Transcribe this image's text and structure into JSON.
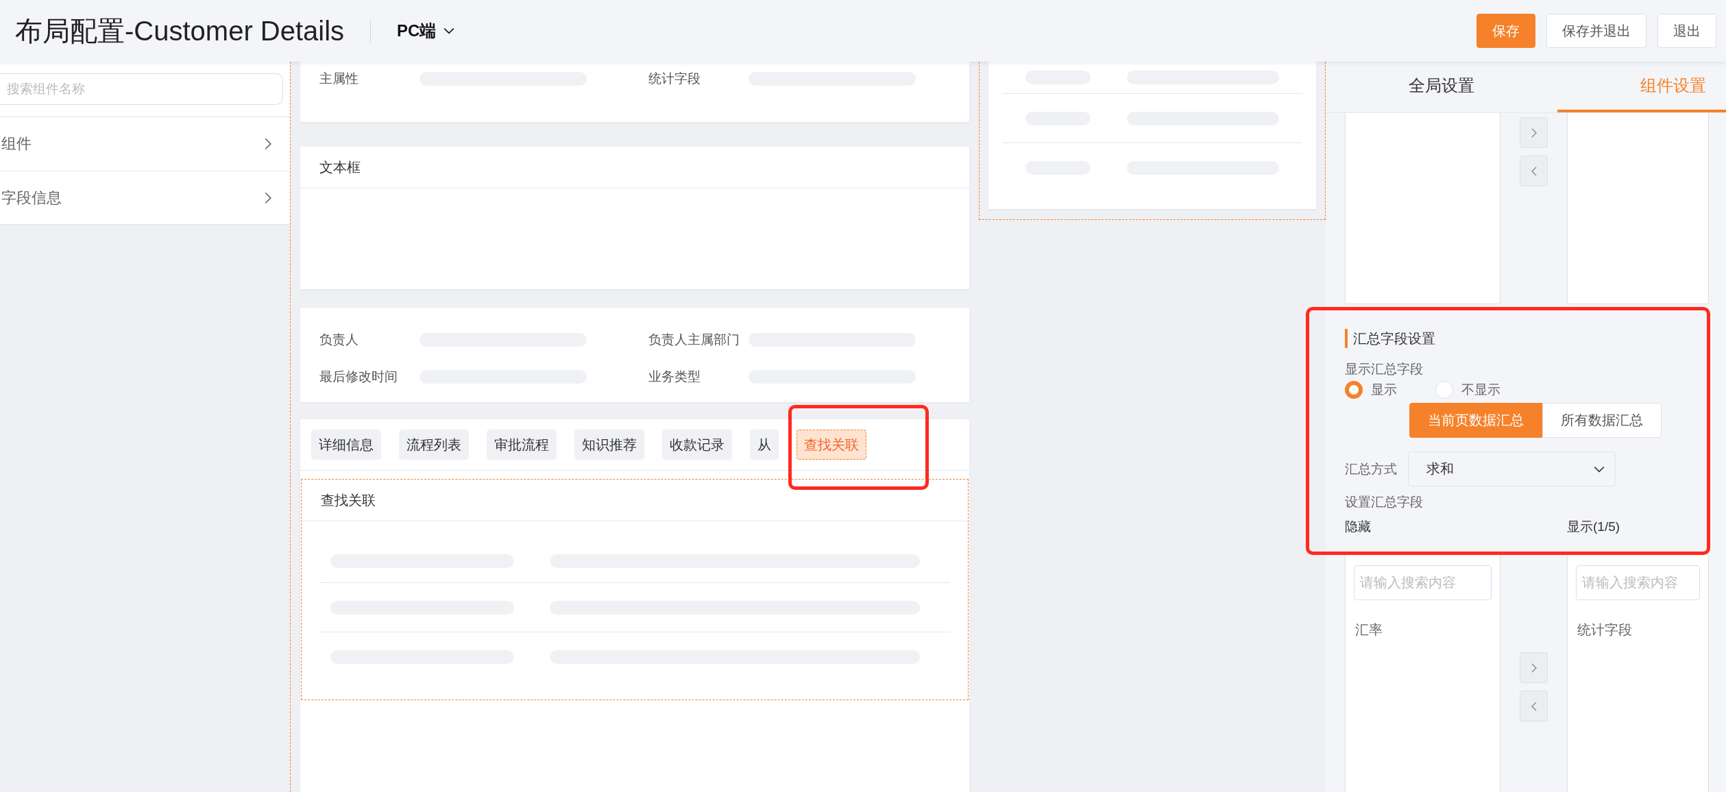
{
  "header": {
    "title": "布局配置-Customer Details",
    "platform": "PC端",
    "buttons": [
      {
        "label": "保存",
        "primary": true
      },
      {
        "label": "保存并退出",
        "primary": false
      },
      {
        "label": "退出",
        "primary": false
      }
    ]
  },
  "sidebar": {
    "search_placeholder": "搜索组件名称",
    "items": [
      {
        "label": "组件"
      },
      {
        "label": "字段信息"
      }
    ]
  },
  "canvas": {
    "attribute_fields": [
      {
        "label": "主属性"
      },
      {
        "label": "统计字段"
      }
    ],
    "text_card": {
      "title": "文本框"
    },
    "owner_fields": [
      {
        "label": "负责人"
      },
      {
        "label": "负责人主属部门"
      },
      {
        "label": "最后修改时间"
      },
      {
        "label": "业务类型"
      }
    ],
    "tabs": [
      {
        "label": "详细信息",
        "selected": false
      },
      {
        "label": "流程列表",
        "selected": false
      },
      {
        "label": "审批流程",
        "selected": false
      },
      {
        "label": "知识推荐",
        "selected": false
      },
      {
        "label": "收款记录",
        "selected": false
      },
      {
        "label": "从",
        "selected": false
      },
      {
        "label": "查找关联",
        "selected": true
      }
    ],
    "related_card": {
      "title": "查找关联"
    }
  },
  "settings": {
    "tabs": [
      {
        "label": "全局设置",
        "selected": false
      },
      {
        "label": "组件设置",
        "selected": true
      }
    ],
    "summary": {
      "title": "汇总字段设置",
      "show_label": "显示汇总字段",
      "radios": [
        {
          "label": "显示",
          "selected": true
        },
        {
          "label": "不显示",
          "selected": false
        }
      ],
      "scope": [
        {
          "label": "当前页数据汇总",
          "selected": true
        },
        {
          "label": "所有数据汇总",
          "selected": false
        }
      ],
      "method_label": "汇总方式",
      "method_value": "求和",
      "fields_label": "设置汇总字段",
      "hidden_label": "隐藏",
      "shown_label": "显示(1/5)"
    },
    "transfer": {
      "left": {
        "placeholder": "请输入搜索内容",
        "items": [
          "汇率"
        ]
      },
      "right": {
        "placeholder": "请输入搜索内容",
        "items": [
          "统计字段"
        ]
      }
    }
  }
}
